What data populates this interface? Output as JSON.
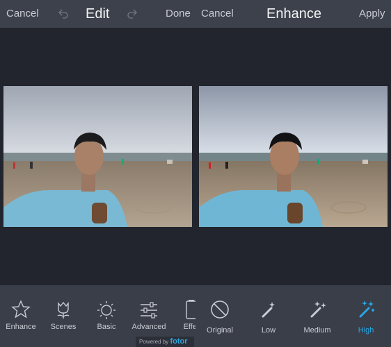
{
  "left_screen": {
    "topbar": {
      "cancel": "Cancel",
      "title": "Edit",
      "done": "Done"
    },
    "tools": [
      {
        "label": "Enhance",
        "icon": "star-icon"
      },
      {
        "label": "Scenes",
        "icon": "tulip-icon"
      },
      {
        "label": "Basic",
        "icon": "sun-icon"
      },
      {
        "label": "Advanced",
        "icon": "sliders-icon"
      },
      {
        "label": "Effec",
        "icon": "effects-icon"
      }
    ],
    "powered_by": "Powered by",
    "brand": "fotor"
  },
  "right_screen": {
    "topbar": {
      "cancel": "Cancel",
      "title": "Enhance",
      "apply": "Apply"
    },
    "options": [
      {
        "label": "Original",
        "icon": "no-sign-icon"
      },
      {
        "label": "Low",
        "icon": "magic-wand-icon"
      },
      {
        "label": "Medium",
        "icon": "magic-wand-icon"
      },
      {
        "label": "High",
        "icon": "magic-wand-icon",
        "selected": true
      }
    ]
  },
  "colors": {
    "accent": "#29a8e6",
    "topbar": "#3d414b",
    "background": "#22252d",
    "bottombar": "#3a3e48"
  }
}
